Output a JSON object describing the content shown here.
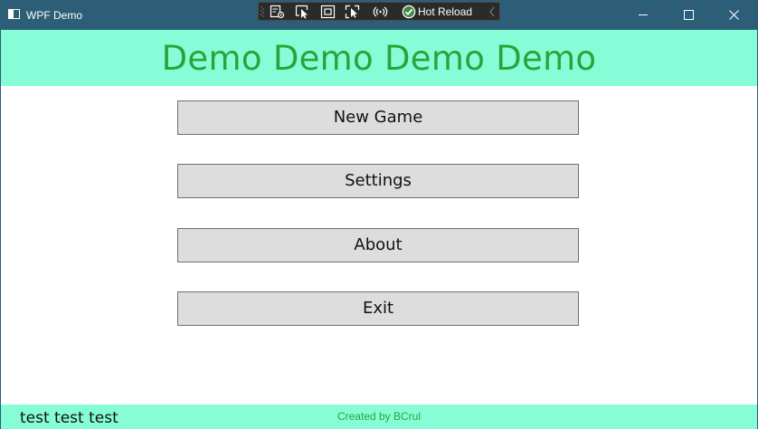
{
  "window": {
    "title": "WPF Demo"
  },
  "xaml_toolbar": {
    "hot_reload_label": "Hot Reload",
    "icons": [
      "live-visual-tree-icon",
      "select-element-icon",
      "display-layout-adorners-icon",
      "track-focus-icon",
      "binding-failures-icon",
      "hot-reload-check-icon",
      "collapse-toolbar-icon"
    ]
  },
  "caption_buttons": [
    "minimize-icon",
    "maximize-icon",
    "close-icon"
  ],
  "header": {
    "title": "Demo Demo Demo Demo"
  },
  "menu": {
    "new_game": "New Game",
    "settings": "Settings",
    "about": "About",
    "exit": "Exit"
  },
  "footer": {
    "left_text": "test test test",
    "credit": "Created by BCrul"
  },
  "colors": {
    "title_bar": "#2c5e78",
    "header_bg": "#86fdd6",
    "header_text": "#2ba33b",
    "button_bg": "#dddddd",
    "button_border": "#707070"
  }
}
